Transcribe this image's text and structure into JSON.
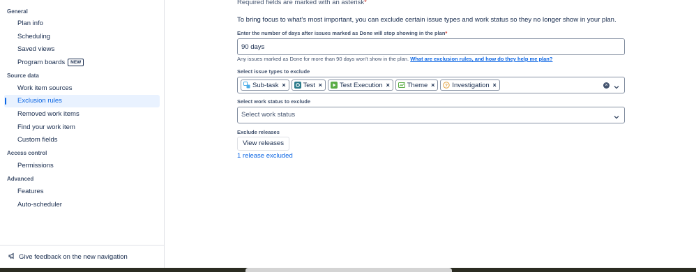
{
  "sidebar": {
    "sections": [
      {
        "title": "General",
        "items": [
          {
            "label": "Plan info"
          },
          {
            "label": "Scheduling"
          },
          {
            "label": "Saved views"
          },
          {
            "label": "Program boards",
            "badge": "NEW"
          }
        ]
      },
      {
        "title": "Source data",
        "items": [
          {
            "label": "Work item sources"
          },
          {
            "label": "Exclusion rules",
            "active": true
          },
          {
            "label": "Removed work items"
          },
          {
            "label": "Find your work item"
          },
          {
            "label": "Custom fields"
          }
        ]
      },
      {
        "title": "Access control",
        "items": [
          {
            "label": "Permissions"
          }
        ]
      },
      {
        "title": "Advanced",
        "items": [
          {
            "label": "Features"
          },
          {
            "label": "Auto-scheduler"
          }
        ]
      }
    ],
    "feedback_label": "Give feedback on the new navigation"
  },
  "main": {
    "required_note": "Required fields are marked with an asterisk",
    "required_star": "*",
    "intro": "To bring focus to what's most important, you can exclude certain issue types and work status so they no longer show in your plan.",
    "days_field": {
      "label": "Enter the number of days after issues marked as Done will stop showing in the plan",
      "value": "90 days",
      "helper": "Any issues marked as Done for more than 90 days won't show in the plan.",
      "helper_link": "What are exclusion rules, and how do they help me plan?"
    },
    "issue_types": {
      "label": "Select issue types to exclude",
      "tags": [
        {
          "label": "Sub-task",
          "icon": "subtask-icon",
          "color": "#4bade8"
        },
        {
          "label": "Test",
          "icon": "test-icon",
          "color": "#2a7a8a"
        },
        {
          "label": "Test Execution",
          "icon": "test-execution-icon",
          "color": "#5aac44"
        },
        {
          "label": "Theme",
          "icon": "theme-icon",
          "color": "#5aac44"
        },
        {
          "label": "Investigation",
          "icon": "investigation-icon",
          "color": "#e2a03f"
        }
      ]
    },
    "work_status": {
      "label": "Select work status to exclude",
      "placeholder": "Select work status"
    },
    "releases": {
      "label": "Exclude releases",
      "button": "View releases",
      "excluded_link": "1 release excluded"
    }
  }
}
